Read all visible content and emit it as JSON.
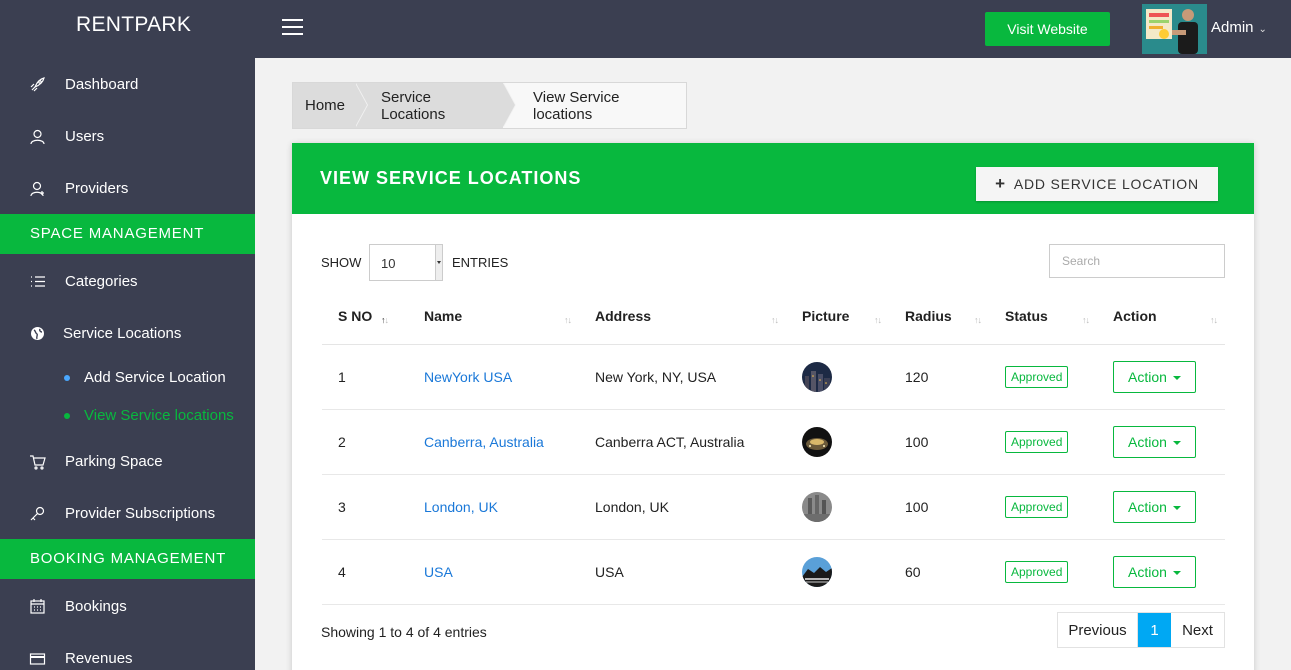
{
  "header": {
    "brand": "RENTPARK",
    "visit_label": "Visit Website",
    "user_name": "Admin",
    "colors": {
      "topbar": "#3b3f51",
      "accent": "#08b83e"
    }
  },
  "sidebar": {
    "items": [
      {
        "label": "Dashboard",
        "icon": "rocket-icon"
      },
      {
        "label": "Users",
        "icon": "user-icon"
      },
      {
        "label": "Providers",
        "icon": "provider-icon"
      }
    ],
    "space_management_title": "SPACE MANAGEMENT",
    "space_items": [
      {
        "label": "Categories",
        "icon": "list-icon"
      },
      {
        "label": "Service Locations",
        "icon": "globe-icon"
      }
    ],
    "sub_items": [
      {
        "label": "Add Service Location"
      },
      {
        "label": "View Service locations",
        "active": true
      }
    ],
    "more_items": [
      {
        "label": "Parking Space",
        "icon": "cart-icon"
      },
      {
        "label": "Provider Subscriptions",
        "icon": "key-icon"
      }
    ],
    "booking_management_title": "BOOKING MANAGEMENT",
    "booking_items": [
      {
        "label": "Bookings",
        "icon": "calendar-icon"
      },
      {
        "label": "Revenues",
        "icon": "credit-card-icon"
      }
    ]
  },
  "breadcrumb": [
    "Home",
    "Service Locations",
    "View Service locations"
  ],
  "card": {
    "title": "VIEW SERVICE LOCATIONS",
    "add_label": "ADD SERVICE LOCATION"
  },
  "table_controls": {
    "show_label": "SHOW",
    "entries_value": "10",
    "entries_label": "ENTRIES",
    "search_placeholder": "Search"
  },
  "table": {
    "columns": [
      "S NO",
      "Name",
      "Address",
      "Picture",
      "Radius",
      "Status",
      "Action"
    ],
    "rows": [
      {
        "sno": "1",
        "name": "NewYork USA",
        "address": "New York, NY, USA",
        "radius": "120",
        "status": "Approved",
        "action": "Action"
      },
      {
        "sno": "2",
        "name": "Canberra, Australia",
        "address": "Canberra ACT, Australia",
        "radius": "100",
        "status": "Approved",
        "action": "Action"
      },
      {
        "sno": "3",
        "name": "London, UK",
        "address": "London, UK",
        "radius": "100",
        "status": "Approved",
        "action": "Action"
      },
      {
        "sno": "4",
        "name": "USA",
        "address": "USA",
        "radius": "60",
        "status": "Approved",
        "action": "Action"
      }
    ]
  },
  "footer": {
    "showing": "Showing 1 to 4 of 4 entries",
    "prev_label": "Previous",
    "page": "1",
    "next_label": "Next"
  }
}
